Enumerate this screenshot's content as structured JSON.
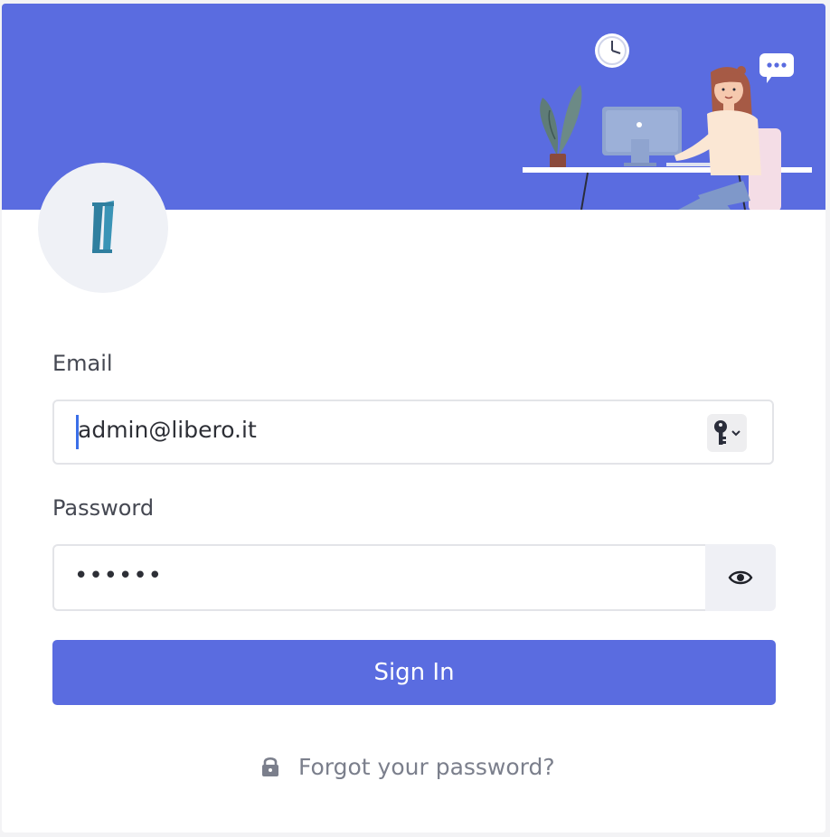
{
  "login": {
    "email_label": "Email",
    "email_value": "admin@libero.it",
    "password_label": "Password",
    "password_value": "••••••",
    "sign_in_label": "Sign In",
    "forgot_label": "Forgot your password?"
  },
  "icons": {
    "logo": "brand-logo-icon",
    "password_manager": "key-icon",
    "toggle_visibility": "eye-icon",
    "forgot": "lock-icon"
  },
  "colors": {
    "primary": "#5a6ce0",
    "logo_teal": "#2f7f9f"
  }
}
